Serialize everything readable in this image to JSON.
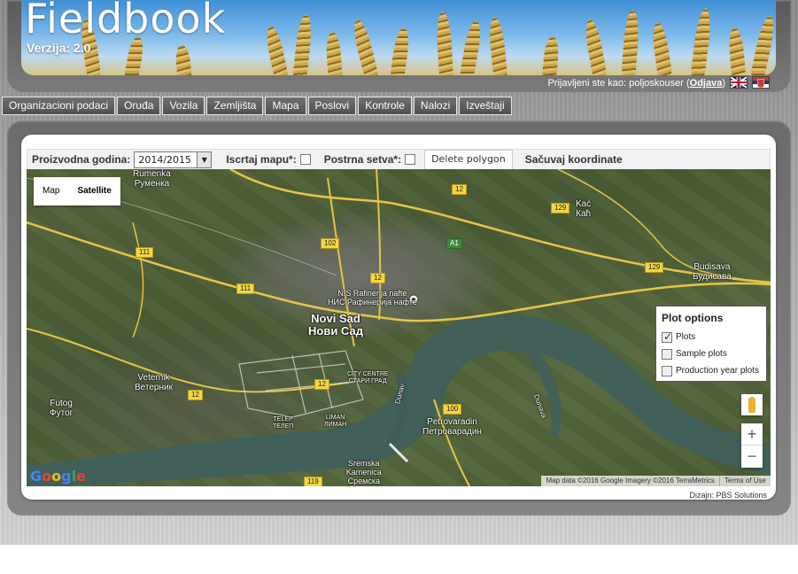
{
  "header": {
    "app_title": "Fieldbook",
    "version": "Verzija: 2.0",
    "login_prefix": "Prijavljeni ste kao: poljoskouser (",
    "logout_label": "Odjava",
    "login_suffix": ")",
    "flags": [
      "uk-flag-icon",
      "serbia-flag-icon"
    ]
  },
  "menu": {
    "items": [
      "Organizacioni podaci",
      "Oruđa",
      "Vozila",
      "Zemljišta",
      "Mapa",
      "Poslovi",
      "Kontrole",
      "Nalozi",
      "Izveštaji"
    ]
  },
  "toolbar": {
    "year_label": "Proizvodna godina:",
    "year_value": "2014/2015",
    "draw_map_label": "Iscrtaj mapu*:",
    "post_sowing_label": "Postrna setva*:",
    "delete_polygon_label": "Delete polygon",
    "save_coords_label": "Sačuvaj koordinate"
  },
  "map": {
    "map_type": {
      "map": "Map",
      "satellite": "Satellite",
      "selected": "Satellite"
    },
    "places": [
      {
        "name": "Rumenka\nРуменка"
      },
      {
        "name": "Novi Sad\nНови Сад"
      },
      {
        "name": "Veternik\nВетерник"
      },
      {
        "name": "Futog\nФутог"
      },
      {
        "name": "Petrovaradin\nПетроварадин"
      },
      {
        "name": "Kać\nКаћ"
      },
      {
        "name": "Budisava\nБудисава"
      },
      {
        "name": "Sremska\nKamenica\nСремска\nКаменица"
      },
      {
        "name": "NIS Rafinerija nafte\nНИС Рафинерија нафте"
      },
      {
        "name": "CITY CENTRE\nСТАРИ ГРАД"
      },
      {
        "name": "TELEP\nТЕЛЕП"
      },
      {
        "name": "LIMAN\nЛИМАН"
      },
      {
        "name": "Dunav"
      },
      {
        "name": "Dunava"
      }
    ],
    "roads": [
      "12",
      "12",
      "12",
      "12",
      "111",
      "111",
      "102",
      "129",
      "129",
      "A1",
      "100",
      "119"
    ],
    "plot_options": {
      "title": "Plot options",
      "items": [
        {
          "label": "Plots",
          "checked": true
        },
        {
          "label": "Sample plots",
          "checked": false
        },
        {
          "label": "Production year plots",
          "checked": false
        }
      ]
    },
    "zoom_in": "+",
    "zoom_out": "−",
    "attribution": "Map data ©2016 Google Imagery ©2016 TerraMetrics",
    "terms": "Terms of Use",
    "logo": "Google"
  },
  "footer": {
    "design_credit": "Dizajn: PBS Solutions"
  }
}
